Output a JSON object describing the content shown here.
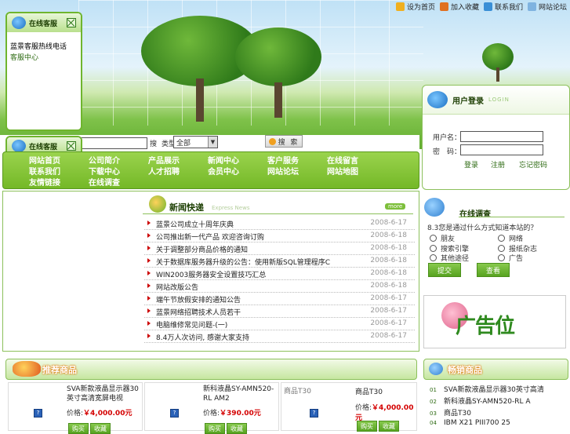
{
  "toplinks": [
    {
      "label": "设为首页",
      "icon": "home-icon"
    },
    {
      "label": "加入收藏",
      "icon": "favorite-icon"
    },
    {
      "label": "联系我们",
      "icon": "contact-icon"
    },
    {
      "label": "网站论坛",
      "icon": "forum-icon"
    }
  ],
  "service": {
    "title": "在线客服",
    "line1": "蓝景客服热线电话",
    "line2": "客服中心",
    "title2": "在线客服"
  },
  "search": {
    "label": "搜",
    "select_prefix": "类型",
    "select_value": "全部",
    "button": "搜 索"
  },
  "nav": {
    "row1": [
      "网站首页",
      "公司简介",
      "产品展示",
      "新闻中心",
      "客户服务",
      "在线留言"
    ],
    "row2": [
      "联系我们",
      "下载中心",
      "人才招聘",
      "会员中心",
      "网站论坛",
      "网站地图"
    ],
    "row3": [
      "友情链接",
      "在线调查"
    ]
  },
  "login": {
    "title": "用户登录",
    "subtitle": "LOGIN",
    "username_label": "用户名：",
    "password_label": "密　码：",
    "register": "注册",
    "login": "登录",
    "forgot": "忘记密码"
  },
  "news": {
    "title": "新闻快递",
    "subtitle": "Express News",
    "more": "more",
    "items": [
      {
        "title": "蓝景公司成立十周年庆典",
        "date": "2008-6-17"
      },
      {
        "title": "公司推出新一代产品 欢迎咨询订购",
        "date": "2008-6-18"
      },
      {
        "title": "关于调整部分商品价格的通知",
        "date": "2008-6-18"
      },
      {
        "title": "关于数据库服务器升级的公告：使用新版SQL管理程序C",
        "date": "2008-6-18"
      },
      {
        "title": "WIN2003服务器安全设置技巧汇总",
        "date": "2008-6-18"
      },
      {
        "title": "网站改版公告",
        "date": "2008-6-18"
      },
      {
        "title": "端午节放假安排的通知公告",
        "date": "2008-6-17"
      },
      {
        "title": "蓝景网络招聘技术人员若干",
        "date": "2008-6-17"
      },
      {
        "title": "电脑维修常见问题-(一)",
        "date": "2008-6-17"
      },
      {
        "title": "8.4万人次访问, 感谢大家支持",
        "date": "2008-6-17"
      }
    ]
  },
  "survey": {
    "title": "在线调查",
    "question": "8.3您是通过什么方式知道本站的？",
    "options": [
      "朋友",
      "网络",
      "搜索引擎",
      "报纸杂志",
      "其他途径",
      "广告"
    ],
    "submit": "提交",
    "view": "查看"
  },
  "ad": {
    "text": "广告位"
  },
  "recommend": {
    "title": "推荐商品",
    "price_label": "价格:",
    "buy": "购买",
    "fav": "收藏",
    "products": [
      {
        "name": "SVA新款液晶显示器30英寸高清宽屏电视",
        "price": "￥4,000.00元"
      },
      {
        "name": "新科液晶SY-AMN520-RL AM2",
        "price": "￥390.00元"
      },
      {
        "image_label": "商品T30",
        "name": "商品T30",
        "price": "￥4,000.00元"
      }
    ]
  },
  "hot": {
    "title": "畅销商品",
    "items": [
      {
        "no": "01",
        "name": "SVA新款液晶显示器30英寸高清"
      },
      {
        "no": "02",
        "name": "新科液晶SY-AMN520-RL A"
      },
      {
        "no": "03",
        "name": "商品T30"
      },
      {
        "no": "04",
        "name": "IBM X21 PIII700 25"
      }
    ]
  }
}
